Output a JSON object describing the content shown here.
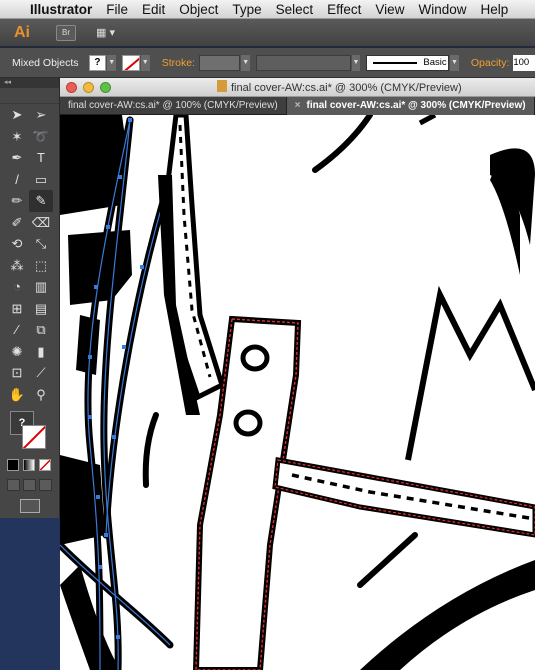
{
  "menubar": {
    "app_name": "Illustrator",
    "items": [
      "File",
      "Edit",
      "Object",
      "Type",
      "Select",
      "Effect",
      "View",
      "Window",
      "Help"
    ]
  },
  "appbar": {
    "logo": "Ai",
    "bridge_label": "Br"
  },
  "controlbar": {
    "selection_label": "Mixed Objects",
    "fill_symbol": "?",
    "stroke_label": "Stroke:",
    "brush_style": "Basic",
    "opacity_label": "Opacity:",
    "opacity_value": "100"
  },
  "document": {
    "window_title": "final cover-AW:cs.ai* @ 300% (CMYK/Preview)",
    "tabs": [
      {
        "label": "final cover-AW:cs.ai* @ 100% (CMYK/Preview)",
        "active": false
      },
      {
        "label": "final cover-AW:cs.ai* @ 300% (CMYK/Preview)",
        "active": true
      }
    ]
  },
  "tools": {
    "icons": [
      "selection-tool-icon",
      "direct-selection-tool-icon",
      "magic-wand-tool-icon",
      "lasso-tool-icon",
      "pen-tool-icon",
      "type-tool-icon",
      "line-tool-icon",
      "rectangle-tool-icon",
      "paintbrush-tool-icon",
      "pencil-tool-icon",
      "blob-brush-tool-icon",
      "eraser-tool-icon",
      "rotate-tool-icon",
      "scale-tool-icon",
      "warp-tool-icon",
      "free-transform-tool-icon",
      "shape-builder-tool-icon",
      "graph-tool-icon",
      "mesh-tool-icon",
      "gradient-tool-icon",
      "eyedropper-tool-icon",
      "blend-tool-icon",
      "symbol-sprayer-tool-icon",
      "column-graph-tool-icon",
      "artboard-tool-icon",
      "slice-tool-icon",
      "hand-tool-icon",
      "zoom-tool-icon"
    ],
    "glyphs": [
      "➤",
      "➢",
      "✶",
      "➰",
      "✒",
      "T",
      "/",
      "▭",
      "✏",
      "✎",
      "✐",
      "⌫",
      "⟲",
      "⤡",
      "⁂",
      "⬚",
      "◔",
      "▥",
      "⊞",
      "▤",
      "⁄",
      "⧉",
      "✺",
      "▮",
      "⊡",
      "⟋",
      "✋",
      "⚲"
    ],
    "selected_index": 9,
    "fill_symbol": "?"
  },
  "colors": {
    "stroke_none_red": "#dd0000",
    "path_blue": "#3b7bd8",
    "path_red": "#e03030",
    "ai_orange": "#e7922a"
  }
}
